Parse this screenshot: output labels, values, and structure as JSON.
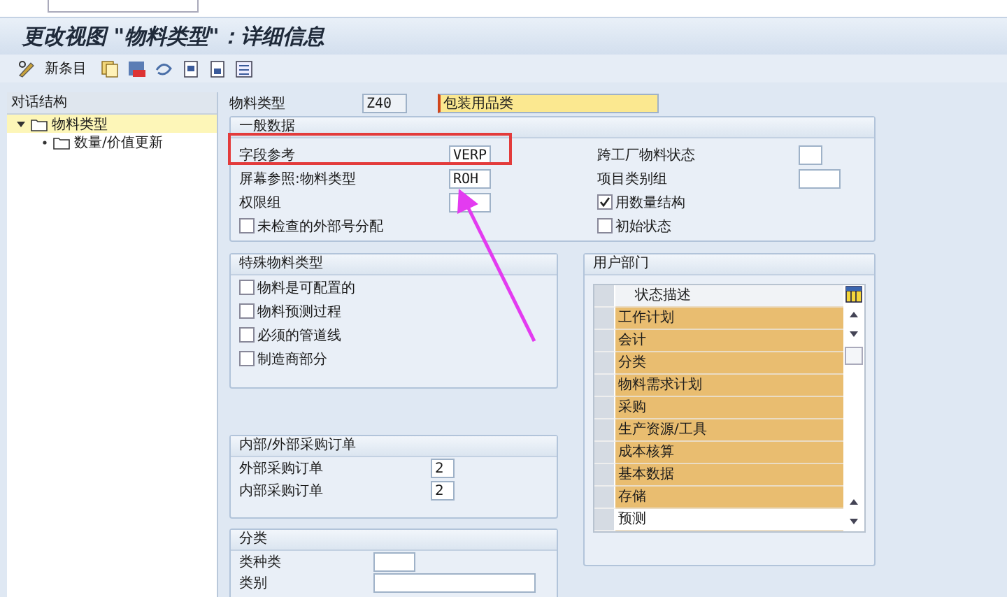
{
  "window": {
    "title": "更改视图 \"物料类型\"：详细信息"
  },
  "toolbar": {
    "new_entries": "新条目"
  },
  "dialog_structure": {
    "title": "对话结构",
    "items": [
      {
        "label": "物料类型",
        "selected": true,
        "expanded": true,
        "children": [
          {
            "label": "数量/价值更新",
            "selected": false
          }
        ]
      }
    ]
  },
  "material_type": {
    "label": "物料类型",
    "code": "Z40",
    "description": "包装用品类"
  },
  "general_data": {
    "title": "一般数据",
    "left_fields": [
      {
        "kind": "short",
        "label": "字段参考",
        "value": "VERP"
      },
      {
        "kind": "short",
        "label": "屏幕参照:物料类型",
        "value": "ROH"
      },
      {
        "kind": "short",
        "label": "权限组"
      },
      {
        "kind": "checkbox",
        "label": "未检查的外部号分配",
        "checked": false
      }
    ],
    "right_fields": [
      {
        "kind": "flag",
        "label": "跨工厂物料状态"
      },
      {
        "kind": "short",
        "label": "项目类别组"
      },
      {
        "kind": "checkbox",
        "label": "用数量结构",
        "checked": true
      },
      {
        "kind": "checkbox",
        "label": "初始状态",
        "checked": false
      }
    ]
  },
  "special_material_types": {
    "title": "特殊物料类型",
    "options": [
      {
        "label": "物料是可配置的",
        "checked": false
      },
      {
        "label": "物料预测过程",
        "checked": false
      },
      {
        "label": "必须的管道线",
        "checked": false
      },
      {
        "label": "制造商部分",
        "checked": false
      }
    ]
  },
  "purchase_orders": {
    "title": "内部/外部采购订单",
    "fields": [
      {
        "kind": "flag",
        "label": "外部采购订单",
        "value": "2"
      },
      {
        "kind": "flag",
        "label": "内部采购订单",
        "value": "2"
      }
    ]
  },
  "classification": {
    "title": "分类",
    "fields": [
      {
        "kind": "short",
        "label": "类种类"
      },
      {
        "kind": "long",
        "label": "类别"
      }
    ]
  },
  "user_departments": {
    "title": "用户部门",
    "column": "状态描述",
    "rows": [
      {
        "label": "工作计划",
        "highlighted": true
      },
      {
        "label": "会计",
        "highlighted": true
      },
      {
        "label": "分类",
        "highlighted": true
      },
      {
        "label": "物料需求计划",
        "highlighted": true
      },
      {
        "label": "采购",
        "highlighted": true
      },
      {
        "label": "生产资源/工具",
        "highlighted": true
      },
      {
        "label": "成本核算",
        "highlighted": true
      },
      {
        "label": "基本数据",
        "highlighted": true
      },
      {
        "label": "存储",
        "highlighted": true
      },
      {
        "label": "预测",
        "highlighted": false
      }
    ]
  },
  "annotations": {
    "highlight_frame": true,
    "arrow": true
  }
}
